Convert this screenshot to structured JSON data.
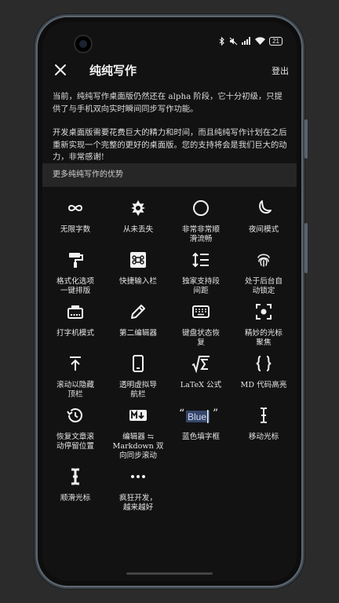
{
  "status": {
    "battery": "21"
  },
  "header": {
    "title": "纯纯写作",
    "logout": "登出"
  },
  "intro": {
    "p1": "当前，纯纯写作桌面版仍然还在 alpha 阶段，它十分初级，只提供了与手机双向实时瞬间同步写作功能。",
    "p2": "开发桌面版需要花费巨大的精力和时间，而且纯纯写作计划在之后重新实现一个完整的更好的桌面版。您的支持将会是我们巨大的动力，非常感谢!"
  },
  "section": {
    "title": "更多纯纯写作的优势"
  },
  "features": [
    {
      "label": "无限字数",
      "icon": "infinity-icon"
    },
    {
      "label": "从未丢失",
      "icon": "gear-icon"
    },
    {
      "label": "非常非常顺\n滑流畅",
      "icon": "circle-icon"
    },
    {
      "label": "夜间模式",
      "icon": "moon-icon"
    },
    {
      "label": "格式化选项\n一键排版",
      "icon": "paint-roller-icon"
    },
    {
      "label": "快捷输入栏",
      "icon": "command-key-icon"
    },
    {
      "label": "独家支持段\n间距",
      "icon": "line-spacing-icon"
    },
    {
      "label": "处于后台自\n动锁定",
      "icon": "fingerprint-icon"
    },
    {
      "label": "打字机模式",
      "icon": "typewriter-icon"
    },
    {
      "label": "第二编辑器",
      "icon": "pencil-icon"
    },
    {
      "label": "键盘状态恢\n复",
      "icon": "keyboard-icon"
    },
    {
      "label": "精妙的光标\n聚焦",
      "icon": "focus-icon"
    },
    {
      "label": "滚动以隐藏\n顶栏",
      "icon": "scroll-top-icon"
    },
    {
      "label": "透明虚拟导\n航栏",
      "icon": "phone-nav-icon"
    },
    {
      "label": "LaTeX 公式",
      "icon": "sqrt-sigma-icon"
    },
    {
      "label": "MD 代码高亮",
      "icon": "braces-icon"
    },
    {
      "label": "恢复文章滚\n动停留位置",
      "icon": "history-icon"
    },
    {
      "label": "编辑器 ⇆\nMarkdown 双\n向同步滚动",
      "icon": "markdown-icon"
    },
    {
      "label": "蓝色填字框",
      "icon": "blue-box-icon",
      "sample": "Blue"
    },
    {
      "label": "移动光标",
      "icon": "text-cursor-icon"
    },
    {
      "label": "顺滑光标",
      "icon": "text-cursor-bold-icon"
    },
    {
      "label": "疯狂开发，\n越来越好",
      "icon": "more-icon"
    }
  ]
}
